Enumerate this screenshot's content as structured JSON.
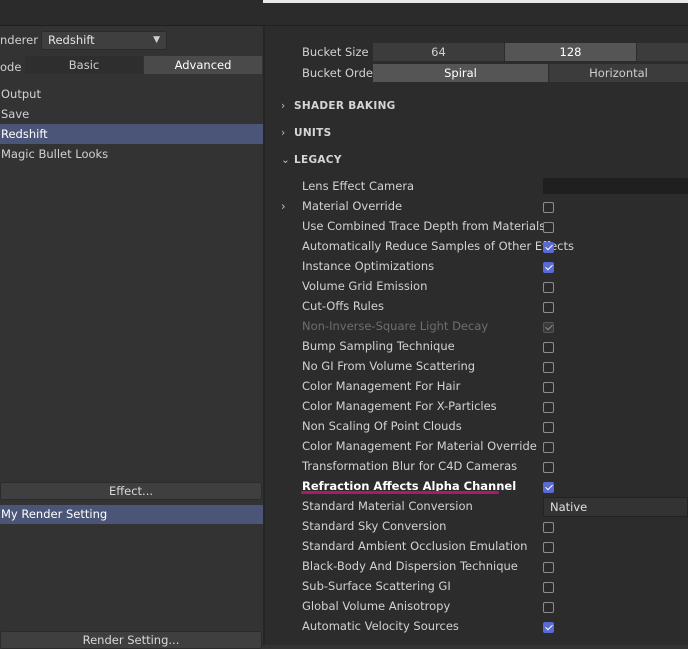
{
  "left_panel": {
    "renderer_label": "nderer",
    "renderer_value": "Redshift",
    "mode_label": "ode",
    "mode_options": [
      "Basic",
      "Advanced"
    ],
    "mode_selected": "Advanced",
    "tree_items": [
      "Output",
      "Save",
      "Redshift",
      "Magic Bullet Looks"
    ],
    "selected_tree_item": "Redshift",
    "effect_button": "Effect...",
    "render_setting_item": "My Render Setting",
    "render_setting_button": "Render Setting..."
  },
  "right_panel": {
    "bucket_size_label": "Bucket Size",
    "bucket_size_options": [
      "64",
      "128"
    ],
    "bucket_size_selected": "128",
    "bucket_order_label": "Bucket Order",
    "bucket_order_options": [
      "Spiral",
      "Horizontal"
    ],
    "bucket_order_selected": "Spiral",
    "sections": [
      "SHADER BAKING",
      "UNITS",
      "LEGACY"
    ],
    "legacy_rows": [
      {
        "label": "Lens Effect Camera",
        "control": "field"
      },
      {
        "label": "Material Override",
        "control": "checkbox",
        "checked": false,
        "expandable": true
      },
      {
        "label": "Use Combined Trace Depth from Materials",
        "control": "checkbox",
        "checked": false
      },
      {
        "label": "Automatically Reduce Samples of Other Effects",
        "control": "checkbox",
        "checked": true
      },
      {
        "label": "Instance Optimizations",
        "control": "checkbox",
        "checked": true
      },
      {
        "label": "Volume Grid Emission",
        "control": "checkbox",
        "checked": false
      },
      {
        "label": "Cut-Offs Rules",
        "control": "checkbox",
        "checked": false
      },
      {
        "label": "Non-Inverse-Square Light Decay",
        "control": "checkbox",
        "checked": true,
        "disabled": true
      },
      {
        "label": "Bump Sampling Technique",
        "control": "checkbox",
        "checked": false
      },
      {
        "label": "No GI From Volume Scattering",
        "control": "checkbox",
        "checked": false
      },
      {
        "label": "Color Management For Hair",
        "control": "checkbox",
        "checked": false
      },
      {
        "label": "Color Management For X-Particles",
        "control": "checkbox",
        "checked": false
      },
      {
        "label": "Non Scaling Of Point Clouds",
        "control": "checkbox",
        "checked": false
      },
      {
        "label": "Color Management For Material Override",
        "control": "checkbox",
        "checked": false
      },
      {
        "label": "Transformation Blur for C4D Cameras",
        "control": "checkbox",
        "checked": false
      },
      {
        "label": "Refraction Affects Alpha Channel",
        "control": "checkbox",
        "checked": true,
        "highlighted": true
      },
      {
        "label": "Standard Material Conversion",
        "control": "dropdown",
        "value": "Native"
      },
      {
        "label": "Standard Sky Conversion",
        "control": "checkbox",
        "checked": false
      },
      {
        "label": "Standard Ambient Occlusion Emulation",
        "control": "checkbox",
        "checked": false
      },
      {
        "label": "Black-Body And Dispersion Technique",
        "control": "checkbox",
        "checked": false
      },
      {
        "label": "Sub-Surface Scattering GI",
        "control": "checkbox",
        "checked": false
      },
      {
        "label": "Global Volume Anisotropy",
        "control": "checkbox",
        "checked": false
      },
      {
        "label": "Automatic Velocity Sources",
        "control": "checkbox",
        "checked": true
      }
    ]
  },
  "colors": {
    "accent": "#5a6ad4",
    "selection": "#4b5577",
    "annotation_underline": "#b0166e"
  }
}
